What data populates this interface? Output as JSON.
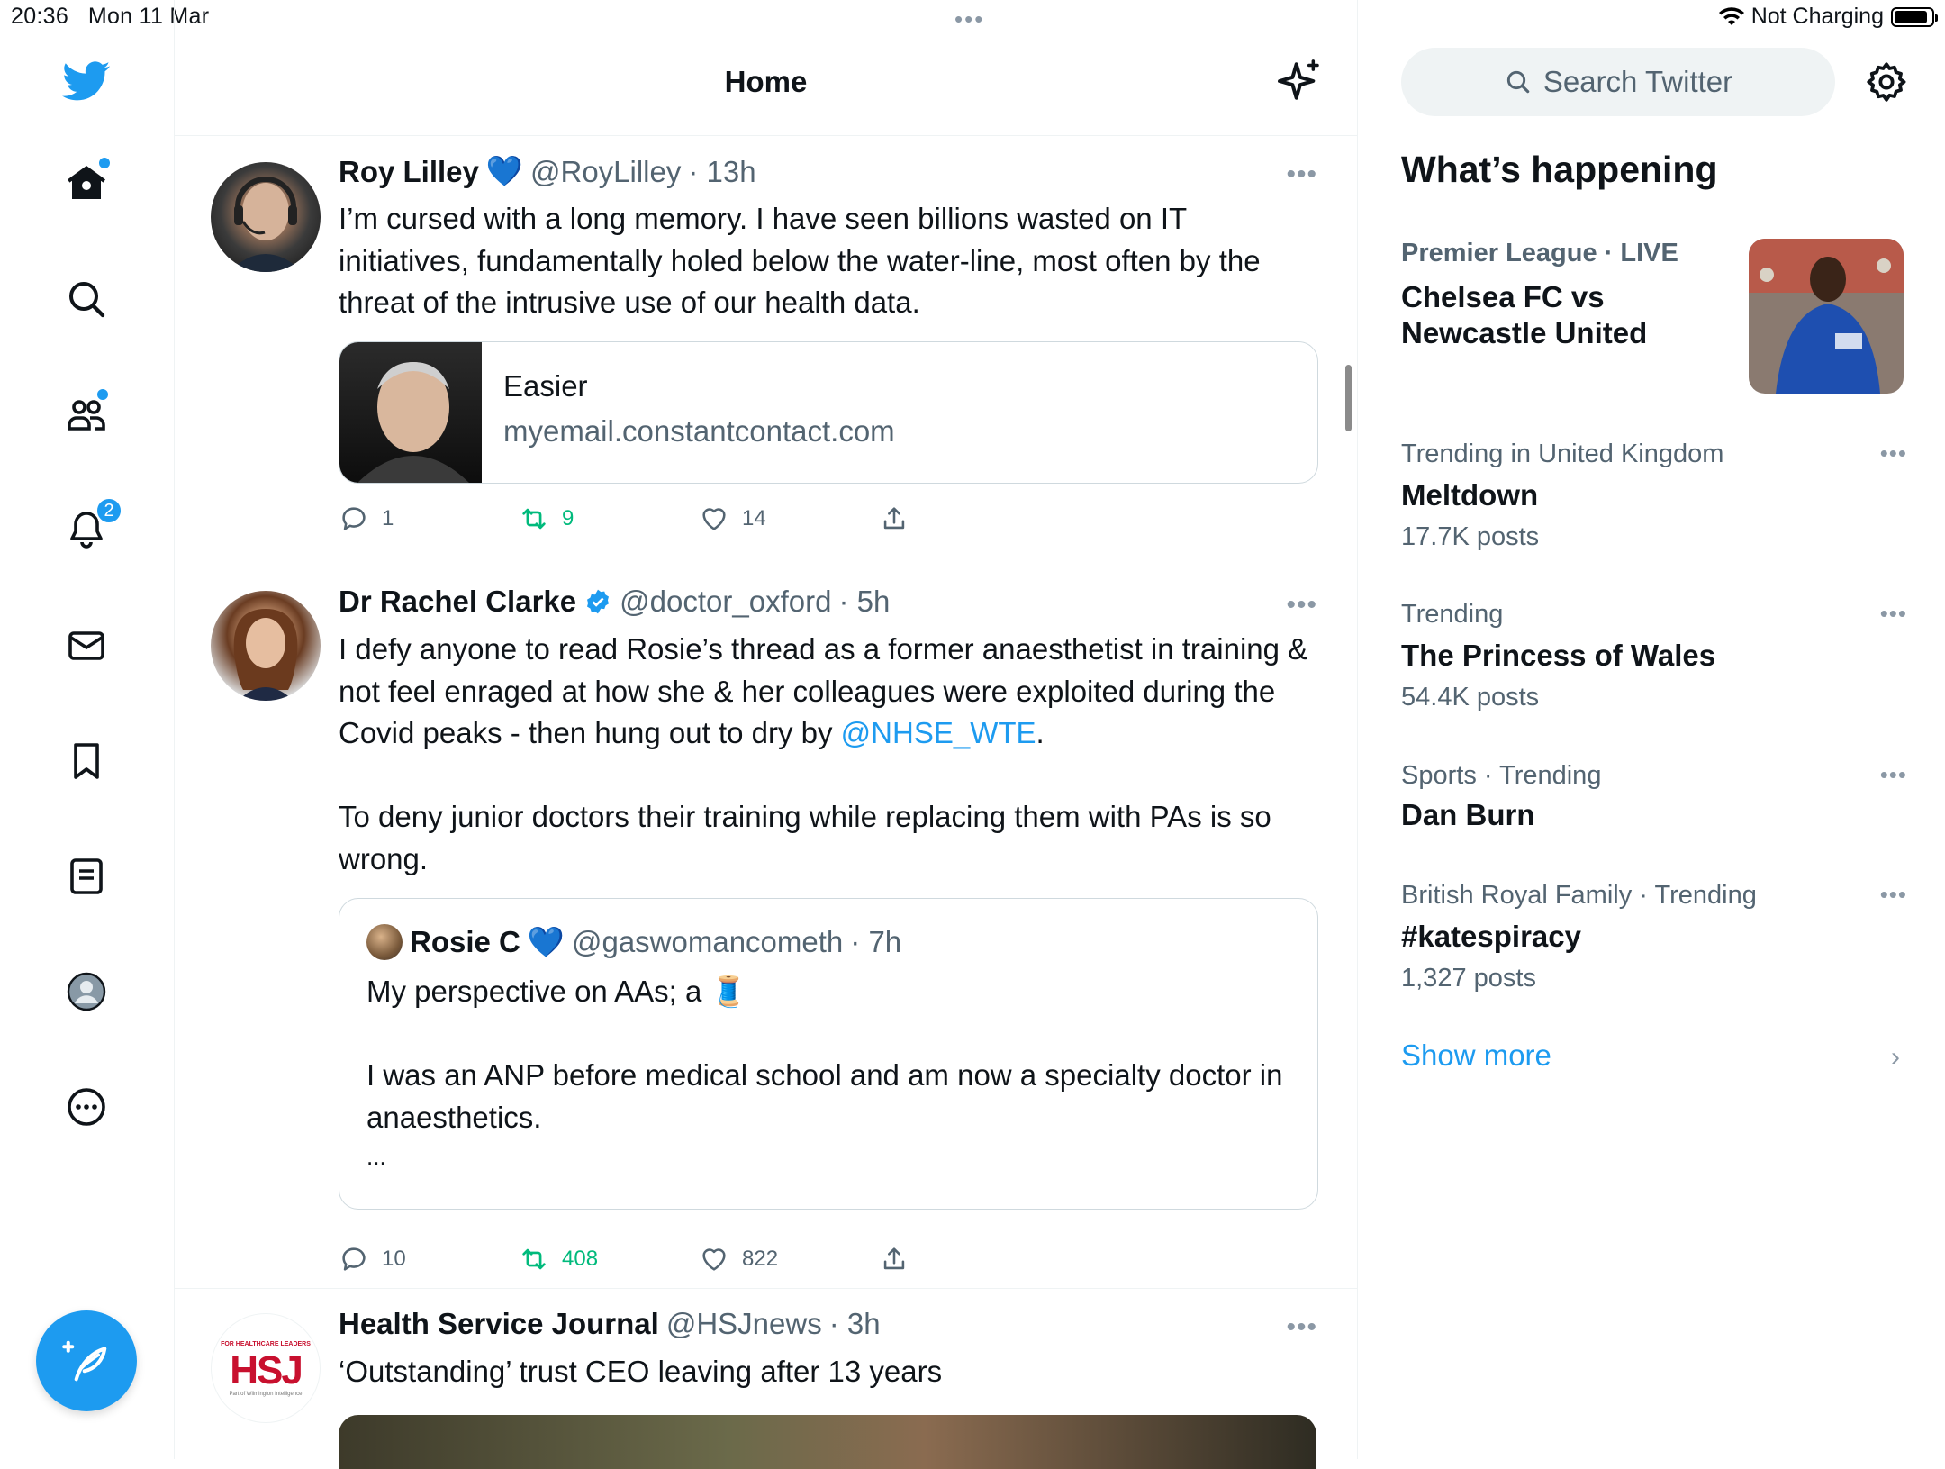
{
  "status": {
    "time": "20:36",
    "date": "Mon 11 Mar",
    "charging": "Not Charging",
    "dots": "•••"
  },
  "nav": {
    "items": [
      "twitter-logo",
      "home",
      "search",
      "communities",
      "notifications",
      "messages",
      "bookmarks",
      "lists",
      "profile",
      "more"
    ],
    "notifications_badge": "2"
  },
  "header": {
    "title": "Home"
  },
  "tweets": [
    {
      "name": "Roy Lilley",
      "handle": "@RoyLilley",
      "time": "· 13h",
      "badge": "💙",
      "text": "I’m cursed with a long memory. I have seen billions wasted on IT initiatives, fundamentally holed below the water-line, most often by the threat of the intrusive use of our health data.",
      "card": {
        "title": "Easier",
        "url": "myemail.constantcontact.com"
      },
      "replies": "1",
      "retweets": "9",
      "likes": "14"
    },
    {
      "name": "Dr Rachel Clarke",
      "handle": "@doctor_oxford",
      "time": "· 5h",
      "text_a": "I defy anyone to read Rosie’s thread as a former anaesthetist in training & not feel enraged at how she & her colleagues were exploited during the Covid peaks - then hung out to dry by ",
      "mention": "@NHSE_WTE",
      "text_b": ".",
      "text_c": "To deny junior doctors their training while replacing them with PAs is so wrong.",
      "quote": {
        "name": "Rosie C",
        "badge": "💙",
        "handle": "@gaswomancometh",
        "time": "· 7h",
        "line1": "My perspective on AAs; a 🧵",
        "line2": "I was an ANP before medical school and am now a specialty doctor in anaesthetics.",
        "line3": "..."
      },
      "replies": "10",
      "retweets": "408",
      "likes": "822"
    },
    {
      "name": "Health Service Journal",
      "handle": "@HSJnews",
      "time": "· 3h",
      "text": "‘Outstanding’ trust CEO leaving after 13 years",
      "avatar_text": "HSJ",
      "avatar_small": "FOR HEALTHCARE LEADERS",
      "avatar_sub": "Part of Wilmington Intelligence"
    }
  ],
  "sidebar": {
    "search_placeholder": "Search Twitter",
    "whats_happening": "What’s happening",
    "trends": [
      {
        "meta": "Premier League · LIVE",
        "title_1": "Chelsea FC vs",
        "title_2": "Newcastle United"
      },
      {
        "meta": "Trending in United Kingdom",
        "title": "Meltdown",
        "count": "17.7K posts"
      },
      {
        "meta": "Trending",
        "title": "The Princess of Wales",
        "count": "54.4K posts"
      },
      {
        "meta": "Sports · Trending",
        "title": "Dan Burn"
      },
      {
        "meta": "British Royal Family · Trending",
        "title": "#katespiracy",
        "count": "1,327 posts"
      }
    ],
    "show_more": "Show more"
  },
  "colors": {
    "accent": "#1d9bf0",
    "retweet": "#00ba7c",
    "secondary": "#536471"
  }
}
